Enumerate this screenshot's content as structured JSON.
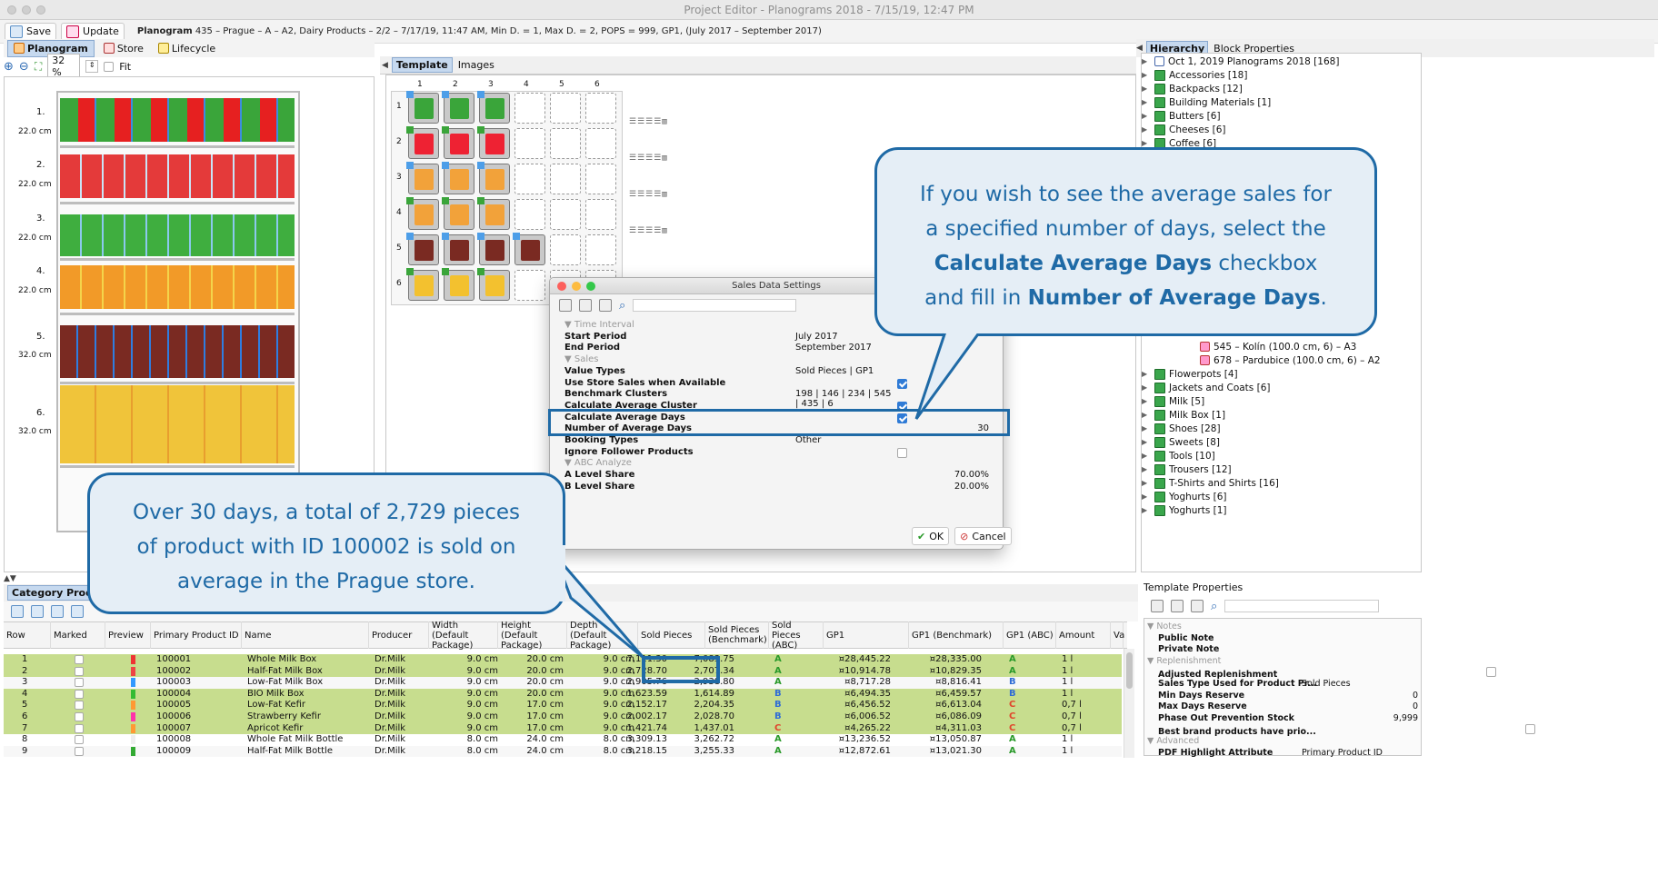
{
  "window": {
    "title": "Project Editor - Planograms 2018 - 7/15/19, 12:47 PM"
  },
  "toolbar": {
    "save": "Save",
    "update": "Update",
    "planogram_label": "Planogram",
    "planogram_info": "435 – Prague – A – A2, Dairy Products – 2/2 – 7/17/19, 11:47 AM, Min D. = 1, Max D. = 2, POPS = 999, GP1, (July 2017 – September 2017)"
  },
  "left_tabs": {
    "planogram": "Planogram",
    "store": "Store",
    "lifecycle": "Lifecycle"
  },
  "zoom": {
    "value": "32 %",
    "fit": "Fit"
  },
  "shelves": [
    {
      "n": "1.",
      "h": "22.0 cm"
    },
    {
      "n": "2.",
      "h": "22.0 cm"
    },
    {
      "n": "3.",
      "h": "22.0 cm"
    },
    {
      "n": "4.",
      "h": "22.0 cm"
    },
    {
      "n": "5.",
      "h": "32.0 cm"
    },
    {
      "n": "6.",
      "h": "32.0 cm"
    }
  ],
  "center_tabs": {
    "template": "Template",
    "images": "Images"
  },
  "template_cols": [
    "1",
    "2",
    "3",
    "4",
    "5",
    "6"
  ],
  "template_rows": [
    "1",
    "2",
    "3",
    "4",
    "5",
    "6"
  ],
  "right_tabs": {
    "hierarchy": "Hierarchy",
    "block": "Block Properties"
  },
  "hierarchy": {
    "root": "Oct 1, 2019 Planograms 2018 [168]",
    "items_top": [
      "Accessories [18]",
      "Backpacks [12]",
      "Building Materials [1]",
      "Butters [6]",
      "Cheeses [6]",
      "Coffee [6]"
    ],
    "sub": [
      "545 – Kolín (100.0 cm, 6) – A3",
      "678 – Pardubice (100.0 cm, 6) – A2"
    ],
    "items_bottom": [
      "Flowerpots [4]",
      "Jackets and Coats [6]",
      "Milk [5]",
      "Milk Box [1]",
      "Shoes [28]",
      "Sweets [8]",
      "Tools [10]",
      "Trousers [12]",
      "T-Shirts and Shirts [16]",
      "Yoghurts [6]",
      "Yoghurts [1]"
    ]
  },
  "dialog": {
    "title": "Sales Data Settings",
    "rows": [
      {
        "k": "Time Interval",
        "v": "",
        "sec": true
      },
      {
        "k": "Start Period",
        "v": "July 2017"
      },
      {
        "k": "End Period",
        "v": "September 2017"
      },
      {
        "k": "Sales",
        "v": "",
        "sec": true
      },
      {
        "k": "Value Types",
        "v": "Sold Pieces | GP1"
      },
      {
        "k": "Use Store Sales when Available",
        "v": "",
        "chk": "on"
      },
      {
        "k": "Benchmark Clusters",
        "v": "198 | 146 | 234 | 545 | 435 | 6"
      },
      {
        "k": "Calculate Average Cluster",
        "v": "",
        "chk": "on"
      },
      {
        "k": "Calculate Average Days",
        "v": "",
        "chk": "on"
      },
      {
        "k": "Number of Average Days",
        "v": "",
        "num": "30"
      },
      {
        "k": "Booking Types",
        "v": "Other"
      },
      {
        "k": "Ignore Follower Products",
        "v": "",
        "chk": "off"
      },
      {
        "k": "ABC Analyze",
        "v": "",
        "sec": true
      },
      {
        "k": "A Level Share",
        "v": "",
        "num": "70.00%"
      },
      {
        "k": "B Level Share",
        "v": "",
        "num": "20.00%"
      }
    ],
    "ok": "OK",
    "cancel": "Cancel"
  },
  "callout_top": {
    "l1": "If you wish to see the average sales for",
    "l2": "a specified number of days, select the",
    "b1": "Calculate Average Days",
    "l3": " checkbox",
    "l4": "and fill in ",
    "b2": "Number of Average Days",
    "l5": "."
  },
  "callout_bottom": {
    "l1": "Over 30 days, a total of 2,729 pieces",
    "l2": "of product with ID 100002 is sold on",
    "l3": "average in the Prague store."
  },
  "bottom_tab": "Category Products",
  "table": {
    "headers": [
      "Row",
      "Marked",
      "Preview",
      "Primary Product ID",
      "Name",
      "Producer",
      "Width (Default Package)",
      "Height (Default Package)",
      "Depth (Default Package)",
      "Sold Pieces",
      "Sold Pieces (Benchmark)",
      "Sold Pieces (ABC)",
      "GP1",
      "GP1 (Benchmark)",
      "GP1 (ABC)",
      "Amount",
      "Va"
    ],
    "rows": [
      {
        "row": "1",
        "id": "100001",
        "name": "Whole Milk Box",
        "prod": "Dr.Milk",
        "w": "9.0 cm",
        "h": "20.0 cm",
        "d": "9.0 cm",
        "sp": "7,111.30",
        "spb": "7,083.75",
        "abc": "A",
        "gp": "¤28,445.22",
        "gpb": "¤28,335.00",
        "gabc": "A",
        "amt": "1 l",
        "green": true
      },
      {
        "row": "2",
        "id": "100002",
        "name": "Half-Fat Milk Box",
        "prod": "Dr.Milk",
        "w": "9.0 cm",
        "h": "20.0 cm",
        "d": "9.0 cm",
        "sp": "2,728.70",
        "spb": "2,707.34",
        "abc": "A",
        "gp": "¤10,914.78",
        "gpb": "¤10,829.35",
        "gabc": "A",
        "amt": "1 l",
        "green": true
      },
      {
        "row": "3",
        "id": "100003",
        "name": "Low-Fat Milk Box",
        "prod": "Dr.Milk",
        "w": "9.0 cm",
        "h": "20.0 cm",
        "d": "9.0 cm",
        "sp": "2,905.76",
        "spb": "2,938.80",
        "abc": "A",
        "gp": "¤8,717.28",
        "gpb": "¤8,816.41",
        "gabc": "B",
        "amt": "1 l",
        "green": false
      },
      {
        "row": "4",
        "id": "100004",
        "name": "BIO Milk Box",
        "prod": "Dr.Milk",
        "w": "9.0 cm",
        "h": "20.0 cm",
        "d": "9.0 cm",
        "sp": "1,623.59",
        "spb": "1,614.89",
        "abc": "B",
        "gp": "¤6,494.35",
        "gpb": "¤6,459.57",
        "gabc": "B",
        "amt": "1 l",
        "green": true
      },
      {
        "row": "5",
        "id": "100005",
        "name": "Low-Fat Kefir",
        "prod": "Dr.Milk",
        "w": "9.0 cm",
        "h": "17.0 cm",
        "d": "9.0 cm",
        "sp": "2,152.17",
        "spb": "2,204.35",
        "abc": "B",
        "gp": "¤6,456.52",
        "gpb": "¤6,613.04",
        "gabc": "C",
        "amt": "0,7 l",
        "green": true
      },
      {
        "row": "6",
        "id": "100006",
        "name": "Strawberry Kefir",
        "prod": "Dr.Milk",
        "w": "9.0 cm",
        "h": "17.0 cm",
        "d": "9.0 cm",
        "sp": "2,002.17",
        "spb": "2,028.70",
        "abc": "B",
        "gp": "¤6,006.52",
        "gpb": "¤6,086.09",
        "gabc": "C",
        "amt": "0,7 l",
        "green": true
      },
      {
        "row": "7",
        "id": "100007",
        "name": "Apricot Kefir",
        "prod": "Dr.Milk",
        "w": "9.0 cm",
        "h": "17.0 cm",
        "d": "9.0 cm",
        "sp": "1,421.74",
        "spb": "1,437.01",
        "abc": "C",
        "gp": "¤4,265.22",
        "gpb": "¤4,311.03",
        "gabc": "C",
        "amt": "0,7 l",
        "green": true
      },
      {
        "row": "8",
        "id": "100008",
        "name": "Whole Fat Milk Bottle",
        "prod": "Dr.Milk",
        "w": "8.0 cm",
        "h": "24.0 cm",
        "d": "8.0 cm",
        "sp": "3,309.13",
        "spb": "3,262.72",
        "abc": "A",
        "gp": "¤13,236.52",
        "gpb": "¤13,050.87",
        "gabc": "A",
        "amt": "1 l",
        "green": false
      },
      {
        "row": "9",
        "id": "100009",
        "name": "Half-Fat Milk Bottle",
        "prod": "Dr.Milk",
        "w": "8.0 cm",
        "h": "24.0 cm",
        "d": "8.0 cm",
        "sp": "3,218.15",
        "spb": "3,255.33",
        "abc": "A",
        "gp": "¤12,872.61",
        "gpb": "¤13,021.30",
        "gabc": "A",
        "amt": "1 l",
        "green": false
      }
    ]
  },
  "tpl_props": {
    "title": "Template Properties",
    "rows": [
      {
        "k": "Notes",
        "v": "",
        "sec": true
      },
      {
        "k": "Public Note",
        "v": ""
      },
      {
        "k": "Private Note",
        "v": ""
      },
      {
        "k": "Replenishment",
        "v": "",
        "sec": true
      },
      {
        "k": "Adjusted Replenishment",
        "v": "",
        "chk": true
      },
      {
        "k": "Sales Type Used for Product Pr...",
        "v": "Sold Pieces"
      },
      {
        "k": "Min Days Reserve",
        "v": "",
        "num": "0"
      },
      {
        "k": "Max Days Reserve",
        "v": "",
        "num": "0"
      },
      {
        "k": "Phase Out Prevention Stock",
        "v": "",
        "num": "9,999"
      },
      {
        "k": "Best brand products have prio...",
        "v": "",
        "chk": true
      },
      {
        "k": "Advanced",
        "v": "",
        "sec": true
      },
      {
        "k": "PDF Highlight Attribute",
        "v": "Primary Product ID"
      }
    ]
  }
}
